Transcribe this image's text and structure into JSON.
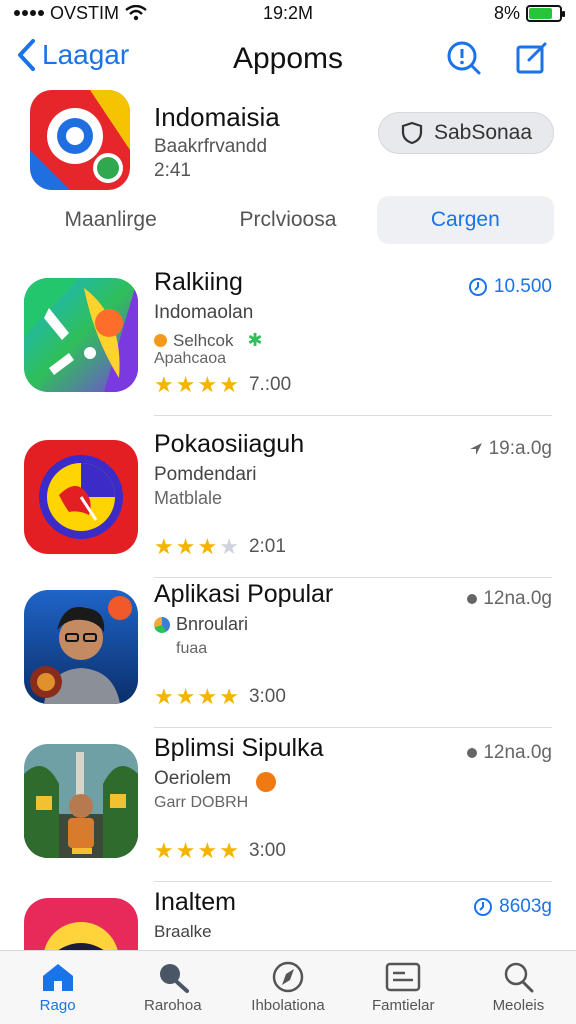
{
  "status": {
    "carrier": "OVSTIM",
    "time": "19:2M",
    "battery": "8%"
  },
  "nav": {
    "back_label": "Laagar",
    "title": "Appoms"
  },
  "featured": {
    "title": "Indomaisia",
    "subtitle": "Baakrfrvandd",
    "time": "2:41",
    "button_label": "SabSonaa"
  },
  "segments": [
    {
      "label": "Maanlirge"
    },
    {
      "label": "Prclvioosa"
    },
    {
      "label": "Cargen"
    }
  ],
  "apps": [
    {
      "name": "Ralkiing",
      "sub1": "Indomaolan",
      "sub2": "Selhcok",
      "sub3": "Apahcaoa",
      "stars": 4,
      "rating": "7.:00",
      "meta": "10.500",
      "meta_style": "blue"
    },
    {
      "name": "Pokaosiiaguh",
      "sub1": "Pomdendari",
      "sub2": "Matblale",
      "sub3": "",
      "stars": 3,
      "rating": "2:01",
      "meta": "19:a.0g",
      "meta_style": "gray"
    },
    {
      "name": "Aplikasi Popular",
      "sub1": "Bnroulari",
      "sub2": "fuaa",
      "sub3": "",
      "stars": 4,
      "rating": "3:00",
      "meta": "12na.0g",
      "meta_style": "gray"
    },
    {
      "name": "Bplimsi Sipulka",
      "sub1": "Oeriolem",
      "sub2": "Garr DOBRH",
      "sub3": "",
      "stars": 4,
      "rating": "3:00",
      "meta": "12na.0g",
      "meta_style": "gray"
    },
    {
      "name": "Inaltem",
      "sub1": "Braalke",
      "sub2": "",
      "sub3": "",
      "stars": 0,
      "rating": "",
      "meta": "8603g",
      "meta_style": "blue"
    }
  ],
  "tabs": [
    {
      "label": "Rago",
      "icon": "home-icon"
    },
    {
      "label": "Rarohoa",
      "icon": "search-icon"
    },
    {
      "label": "Ihbolationa",
      "icon": "compass-icon"
    },
    {
      "label": "Famtielar",
      "icon": "list-card-icon"
    },
    {
      "label": "Meoleis",
      "icon": "search-icon"
    }
  ],
  "colors": {
    "accent": "#1a73e8",
    "star": "#f5b400",
    "tab_bg": "#f7f7f8"
  }
}
